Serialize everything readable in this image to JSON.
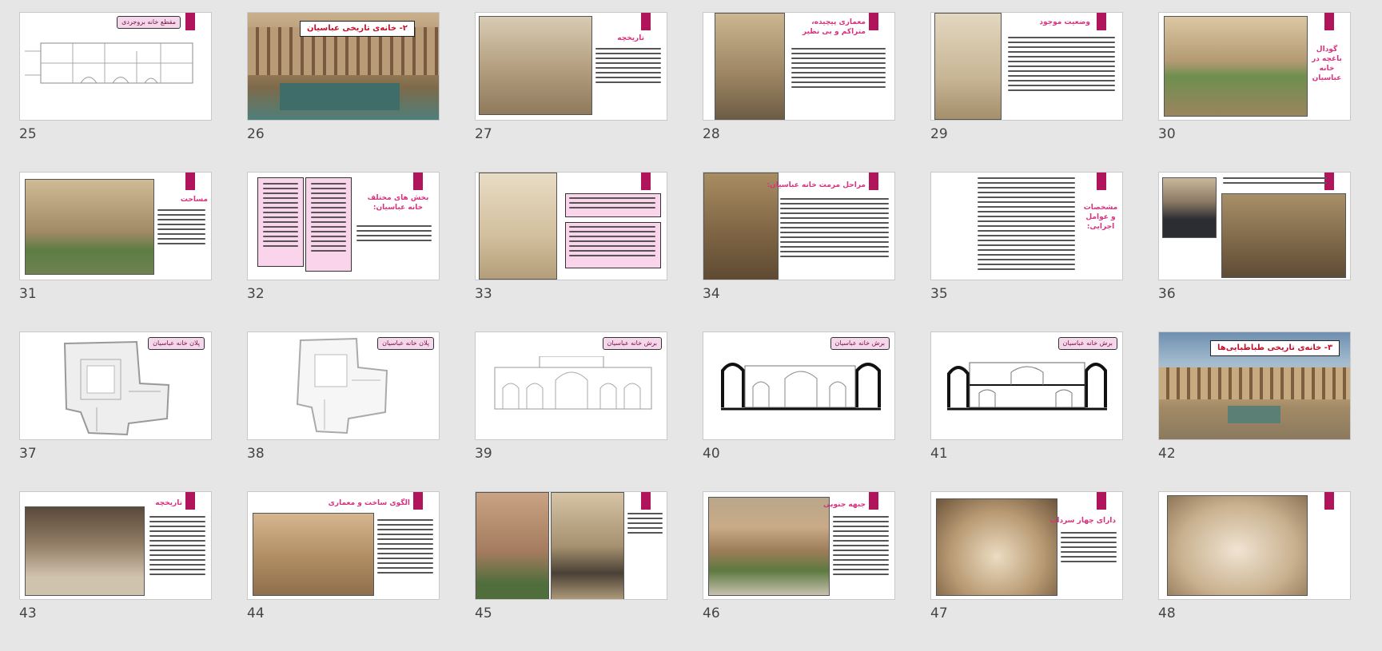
{
  "colors": {
    "accent": "#b0145a",
    "title": "#d8337f",
    "banner_text": "#c4102f",
    "label_bg": "#f4d7ea",
    "pink_box": "#f9d4ea"
  },
  "slides": [
    {
      "num": "25",
      "kind": "drawing",
      "label": "مقطع خانه بروجردی"
    },
    {
      "num": "26",
      "kind": "banner",
      "banner": "۲- خانه‌ی تاریخی عباسیان"
    },
    {
      "num": "27",
      "kind": "photo-left",
      "title": "تاریخچه"
    },
    {
      "num": "28",
      "kind": "photo-left-narrow",
      "title": "معماری پیچیده، متراکم و بی نظیر"
    },
    {
      "num": "29",
      "kind": "photo-left-narrow",
      "title": "وضعیت موجود"
    },
    {
      "num": "30",
      "kind": "photo-left-wide",
      "title": "گودال باغچه در خانه عباسیان"
    },
    {
      "num": "31",
      "kind": "photo-left",
      "title": "مساحت"
    },
    {
      "num": "32",
      "kind": "lists",
      "title": "بخش های مختلف خانه عباسیان:"
    },
    {
      "num": "33",
      "kind": "photo-boxes",
      "title": ""
    },
    {
      "num": "34",
      "kind": "photo-text",
      "title": "مراحل مرمت خانه عباسیان:"
    },
    {
      "num": "35",
      "kind": "text-list",
      "title": "مشخصات و عوامل اجرایی:"
    },
    {
      "num": "36",
      "kind": "portrait",
      "title": ""
    },
    {
      "num": "37",
      "kind": "plan",
      "label": "پلان خانه عباسیان"
    },
    {
      "num": "38",
      "kind": "plan",
      "label": "پلان خانه عباسیان"
    },
    {
      "num": "39",
      "kind": "elevation",
      "label": "برش خانه عباسیان"
    },
    {
      "num": "40",
      "kind": "section",
      "label": "برش خانه عباسیان"
    },
    {
      "num": "41",
      "kind": "section",
      "label": "برش خانه عباسیان"
    },
    {
      "num": "42",
      "kind": "banner",
      "banner": "۳- خانه‌ی تاریخی طباطبایی‌ها"
    },
    {
      "num": "43",
      "kind": "photo-left",
      "title": "تاریخچه"
    },
    {
      "num": "44",
      "kind": "photo-left",
      "title": "الگوی ساخت و معماری"
    },
    {
      "num": "45",
      "kind": "two-photos",
      "title": ""
    },
    {
      "num": "46",
      "kind": "photo-left",
      "title": "جبهه جنوبی"
    },
    {
      "num": "47",
      "kind": "photo-left",
      "title": "دارای چهار سرداب"
    },
    {
      "num": "48",
      "kind": "photo-center",
      "title": ""
    }
  ]
}
